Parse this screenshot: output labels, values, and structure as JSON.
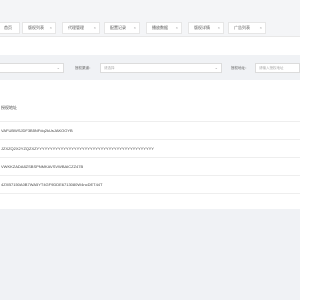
{
  "tabs": [
    {
      "label": "首页"
    },
    {
      "label": "版权列表"
    },
    {
      "label": "代理管理"
    },
    {
      "label": "配置记录"
    },
    {
      "label": "播放数据"
    },
    {
      "label": "版权详情"
    },
    {
      "label": "广告列表"
    }
  ],
  "filters": {
    "select1_placeholder": "",
    "label2": "授权渠道：",
    "select2_placeholder": "请选择",
    "label3": "授权地址：",
    "input3_placeholder": "请输入授权地址"
  },
  "table": {
    "header": "授权地址",
    "rows": [
      "VAFUBWSJDF3B5NFdq2kUsJAKOOYB",
      "JZXZQ2X2YZQZXZYYYYYYYYYYYYYYYYYYYYYYYYYYYYYYYYYYYYYYYYYYYY",
      "VWKKZADA8ZSBSPNMKAVSVWBAICZZ47B",
      "4ZXB7150A0B7WA5YT4GF9DDE6713080W4ncDET44T"
    ]
  }
}
